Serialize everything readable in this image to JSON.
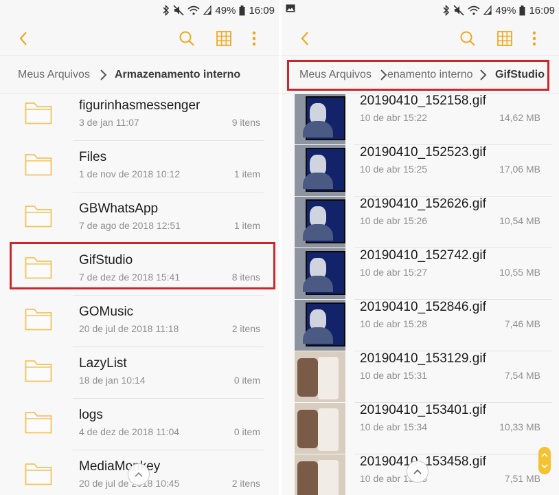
{
  "colors": {
    "accent": "#f0a91e",
    "folder": "#f5c15a",
    "highlight": "#c8282c",
    "secondary_text": "#8f8f8f"
  },
  "left": {
    "status": {
      "battery": "49%",
      "time": "16:09",
      "icons": [
        "bluetooth-icon",
        "mute-icon",
        "wifi-icon",
        "signal-icon",
        "battery-icon"
      ]
    },
    "toolbar": {
      "back_icon": "back-chevron-icon",
      "search_icon": "search-icon",
      "grid_icon": "grid-view-icon",
      "more_icon": "more-vert-icon"
    },
    "breadcrumb": {
      "root": "Meus Arquivos",
      "current": "Armazenamento interno"
    },
    "folders": [
      {
        "name": "figurinhasmessenger",
        "date": "3 de jan 11:07",
        "count": "9 itens"
      },
      {
        "name": "Files",
        "date": "1 de nov de 2018 10:12",
        "count": "1 item"
      },
      {
        "name": "GBWhatsApp",
        "date": "7 de ago de 2018 12:51",
        "count": "1 item"
      },
      {
        "name": "GifStudio",
        "date": "7 de dez de 2018 15:41",
        "count": "8 itens"
      },
      {
        "name": "GOMusic",
        "date": "20 de jul de 2018 11:18",
        "count": "2 itens"
      },
      {
        "name": "LazyList",
        "date": "18 de jan 10:14",
        "count": "0 item"
      },
      {
        "name": "logs",
        "date": "4 de dez de 2018 11:04",
        "count": "0 item"
      },
      {
        "name": "MediaMonkey",
        "date": "20 de jul de 2018 10:45",
        "count": "2 itens"
      }
    ]
  },
  "right": {
    "status": {
      "battery": "49%",
      "time": "16:09",
      "icons": [
        "image-notification-icon",
        "bluetooth-icon",
        "mute-icon",
        "wifi-icon",
        "signal-icon",
        "battery-icon"
      ]
    },
    "toolbar": {
      "back_icon": "back-chevron-icon",
      "search_icon": "search-icon",
      "grid_icon": "grid-view-icon",
      "more_icon": "more-vert-icon"
    },
    "breadcrumb": {
      "root": "Meus Arquivos",
      "middle": "enamento interno",
      "current": "GifStudio"
    },
    "files": [
      {
        "name": "20190410_152158.gif",
        "date": "10 de abr 15:22",
        "size": "14,62 MB"
      },
      {
        "name": "20190410_152523.gif",
        "date": "10 de abr 15:25",
        "size": "17,06 MB"
      },
      {
        "name": "20190410_152626.gif",
        "date": "10 de abr 15:26",
        "size": "10,54 MB"
      },
      {
        "name": "20190410_152742.gif",
        "date": "10 de abr 15:27",
        "size": "10,55 MB"
      },
      {
        "name": "20190410_152846.gif",
        "date": "10 de abr 15:28",
        "size": "7,46 MB"
      },
      {
        "name": "20190410_153129.gif",
        "date": "10 de abr 15:31",
        "size": "7,54 MB"
      },
      {
        "name": "20190410_153401.gif",
        "date": "10 de abr 15:34",
        "size": "10,33 MB"
      },
      {
        "name": "20190410_153458.gif",
        "date": "10 de abr 15:35",
        "size": "7,51 MB"
      }
    ]
  }
}
